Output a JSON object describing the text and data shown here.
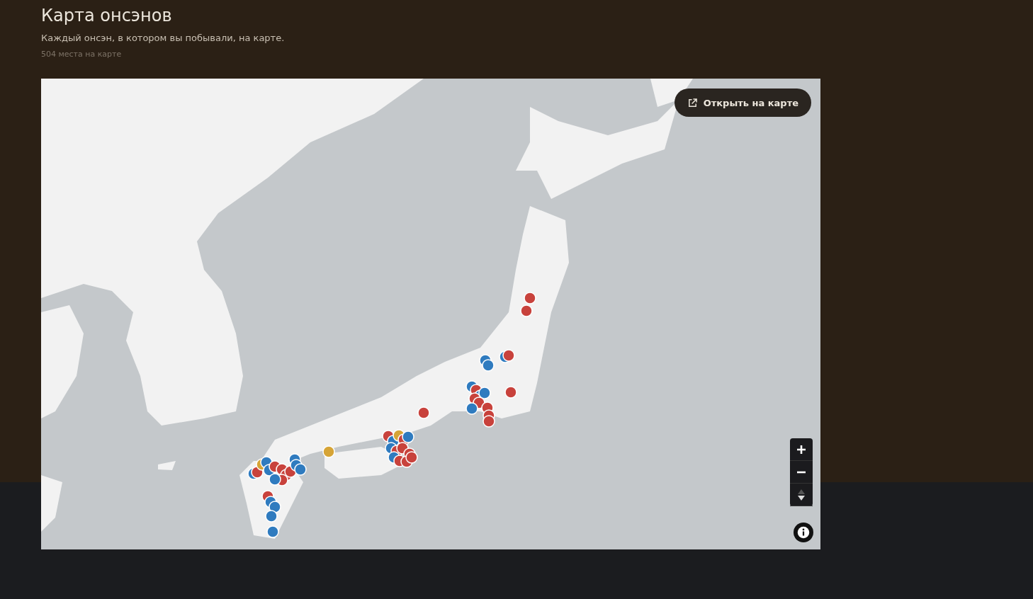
{
  "page": {
    "title": "Карта онсэнов",
    "subtitle": "Каждый онсэн, в котором вы побывали, на карте.",
    "count": "504 места на карте"
  },
  "map": {
    "open_button": "Открыть на карте"
  }
}
